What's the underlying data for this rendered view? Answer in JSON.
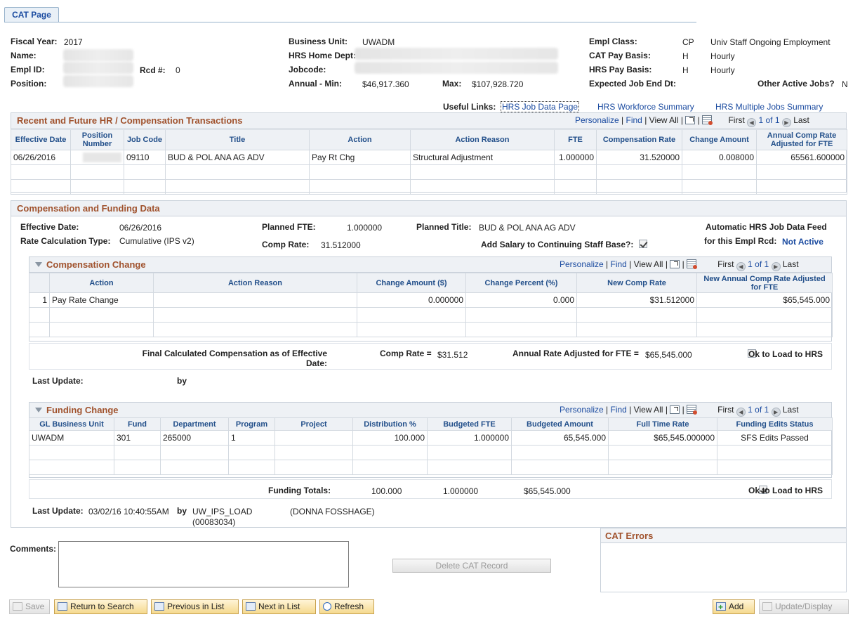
{
  "tab": {
    "label": "CAT Page"
  },
  "header": {
    "fiscal_year_label": "Fiscal Year:",
    "fiscal_year": "2017",
    "name_label": "Name:",
    "empl_id_label": "Empl ID:",
    "rcd_label": "Rcd #:",
    "rcd": "0",
    "position_label": "Position:",
    "business_unit_label": "Business Unit:",
    "business_unit": "UWADM",
    "hrs_home_dept_label": "HRS Home Dept:",
    "jobcode_label": "Jobcode:",
    "annual_min_label": "Annual - Min:",
    "annual_min": "$46,917.360",
    "max_label": "Max:",
    "max": "$107,928.720",
    "empl_class_label": "Empl Class:",
    "empl_class_code": "CP",
    "empl_class_desc": "Univ Staff Ongoing Employment",
    "cat_pay_basis_label": "CAT Pay Basis:",
    "cat_pay_basis_code": "H",
    "cat_pay_basis_desc": "Hourly",
    "hrs_pay_basis_label": "HRS Pay Basis:",
    "hrs_pay_basis_code": "H",
    "hrs_pay_basis_desc": "Hourly",
    "expected_end_label": "Expected Job End Dt:",
    "other_active_jobs_label": "Other Active Jobs?",
    "other_active_jobs": "N"
  },
  "useful_links": {
    "label": "Useful Links:",
    "items": [
      "HRS Job Data Page",
      "HRS Workforce Summary",
      "HRS Multiple Jobs Summary"
    ]
  },
  "grid_nav": {
    "personalize": "Personalize",
    "find": "Find",
    "view_all": "View All",
    "first": "First",
    "last": "Last",
    "range": "1 of 1",
    "sep": "|"
  },
  "transactions": {
    "title": "Recent and Future HR / Compensation Transactions",
    "columns": [
      "Effective Date",
      "Position Number",
      "Job Code",
      "Title",
      "Action",
      "Action Reason",
      "FTE",
      "Compensation Rate",
      "Change Amount",
      "Annual Comp Rate Adjusted for FTE"
    ],
    "rows": [
      [
        "06/26/2016",
        "",
        "09110",
        "BUD & POL ANA AG ADV",
        "Pay Rt Chg",
        "Structural Adjustment",
        "1.000000",
        "31.520000",
        "0.008000",
        "65561.600000"
      ]
    ]
  },
  "comp_funding": {
    "title": "Compensation and Funding Data",
    "effective_date_label": "Effective Date:",
    "effective_date": "06/26/2016",
    "rate_calc_label": "Rate Calculation Type:",
    "rate_calc": "Cumulative (IPS v2)",
    "planned_fte_label": "Planned FTE:",
    "planned_fte": "1.000000",
    "comp_rate_label": "Comp Rate:",
    "comp_rate": "31.512000",
    "planned_title_label": "Planned Title:",
    "planned_title": "BUD & POL ANA AG ADV",
    "add_salary_label": "Add Salary to Continuing Staff Base?:",
    "add_salary_checked": true,
    "auto_feed_label_1": "Automatic HRS Job Data Feed",
    "auto_feed_label_2": "for this Empl Rcd:",
    "auto_feed_status": "Not Active"
  },
  "comp_change": {
    "title": "Compensation Change",
    "columns": [
      "",
      "Action",
      "Action Reason",
      "Change Amount ($)",
      "Change Percent (%)",
      "New Comp Rate",
      "New Annual Comp Rate Adjusted for FTE"
    ],
    "rows": [
      [
        "1",
        "Pay Rate Change",
        "",
        "0.000000",
        "0.000",
        "$31.512000",
        "$65,545.000"
      ]
    ],
    "final_label": "Final Calculated Compensation as of Effective Date:",
    "final_comp_rate_label": "Comp Rate =",
    "final_comp_rate": "$31.512",
    "final_annual_label": "Annual Rate Adjusted for FTE =",
    "final_annual": "$65,545.000",
    "ok_load_label": "Ok to Load to HRS",
    "ok_load_checked": false,
    "last_update_label": "Last Update:",
    "by_label": "by"
  },
  "funding_change": {
    "title": "Funding Change",
    "columns": [
      "GL Business Unit",
      "Fund",
      "Department",
      "Program",
      "Project",
      "Distribution %",
      "Budgeted FTE",
      "Budgeted Amount",
      "Full Time Rate",
      "Funding Edits Status"
    ],
    "rows": [
      [
        "UWADM",
        "301",
        "265000",
        "1",
        "",
        "100.000",
        "1.000000",
        "65,545.000",
        "$65,545.000000",
        "SFS Edits Passed"
      ]
    ],
    "totals_label": "Funding Totals:",
    "totals_dist": "100.000",
    "totals_fte": "1.000000",
    "totals_amount": "$65,545.000",
    "ok_load_label": "Ok to Load to HRS",
    "ok_load_checked": true,
    "last_update_label": "Last Update:",
    "last_update": "03/02/16 10:40:55AM",
    "by_label": "by",
    "by_user": "UW_IPS_LOAD",
    "by_id": "(00083034)",
    "by_name": "(DONNA FOSSHAGE)"
  },
  "comments": {
    "label": "Comments:",
    "value": ""
  },
  "delete_button": "Delete CAT Record",
  "cat_errors": {
    "title": "CAT Errors"
  },
  "toolbar": {
    "save": "Save",
    "return_to_search": "Return to Search",
    "previous_in_list": "Previous in List",
    "next_in_list": "Next in List",
    "refresh": "Refresh",
    "add": "Add",
    "update_display": "Update/Display"
  }
}
